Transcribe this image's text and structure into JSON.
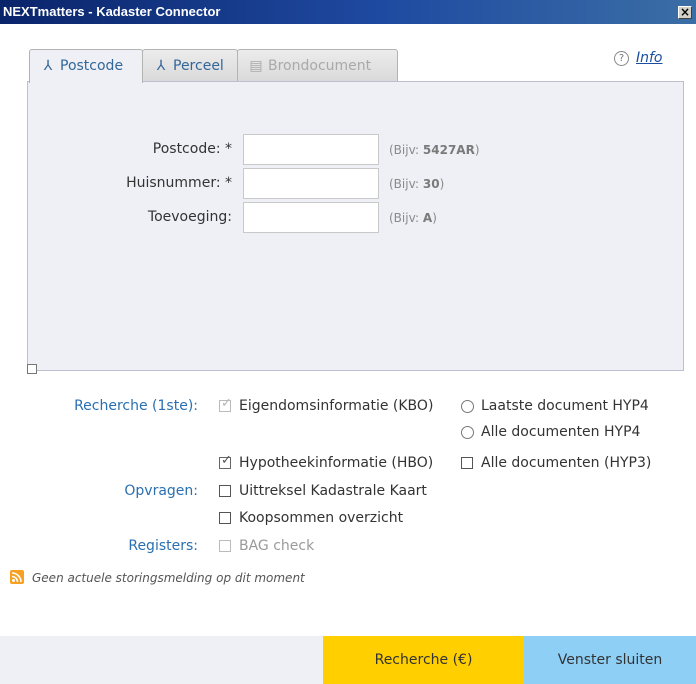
{
  "window": {
    "title": "NEXTmatters - Kadaster Connector",
    "close_glyph": "×"
  },
  "tabs": [
    {
      "label": "Postcode",
      "icon": "survey-marker-icon",
      "glyph": "⅄",
      "state": "active"
    },
    {
      "label": "Perceel",
      "icon": "survey-marker-icon",
      "glyph": "⅄",
      "state": "normal"
    },
    {
      "label": "Brondocument",
      "icon": "document-icon",
      "glyph": "▤",
      "state": "disabled"
    }
  ],
  "info": {
    "icon_glyph": "?",
    "label": "Info"
  },
  "form": {
    "fields": [
      {
        "label": "Postcode: *",
        "value": "",
        "hint_prefix": "(Bijv: ",
        "hint_value": "5427AR",
        "hint_suffix": ")"
      },
      {
        "label": "Huisnummer: *",
        "value": "",
        "hint_prefix": "(Bijv: ",
        "hint_value": "30",
        "hint_suffix": ")"
      },
      {
        "label": "Toevoeging:",
        "value": "",
        "hint_prefix": "(Bijv: ",
        "hint_value": "A",
        "hint_suffix": ")"
      }
    ]
  },
  "options": {
    "recherche_label": "Recherche (1ste):",
    "opvragen_label": "Opvragen:",
    "registers_label": "Registers:",
    "eigendom": {
      "label": "Eigendomsinformatie (KBO)",
      "checked": true,
      "disabled": true
    },
    "laatste_doc": {
      "label": "Laatste document HYP4",
      "selected": false
    },
    "alle_doc_hyp4": {
      "label": "Alle documenten HYP4",
      "selected": false
    },
    "hypotheek": {
      "label": "Hypotheekinformatie (HBO)",
      "checked": true
    },
    "alle_doc_hyp3": {
      "label": "Alle documenten (HYP3)",
      "checked": false
    },
    "uittreksel": {
      "label": "Uittreksel Kadastrale Kaart",
      "checked": false
    },
    "koopsommen": {
      "label": "Koopsommen overzicht",
      "checked": false
    },
    "bag_check": {
      "label": "BAG check",
      "checked": false,
      "disabled": true
    }
  },
  "notice": {
    "icon": "rss-icon",
    "text": "Geen actuele storingsmelding op dit moment"
  },
  "footer": {
    "primary_label": "Recherche (€)",
    "secondary_label": "Venster sluiten"
  },
  "colors": {
    "accent": "#2a6fb0",
    "primary_button": "#ffcf00",
    "secondary_button": "#8ecff6",
    "panel": "#eef0f5"
  }
}
